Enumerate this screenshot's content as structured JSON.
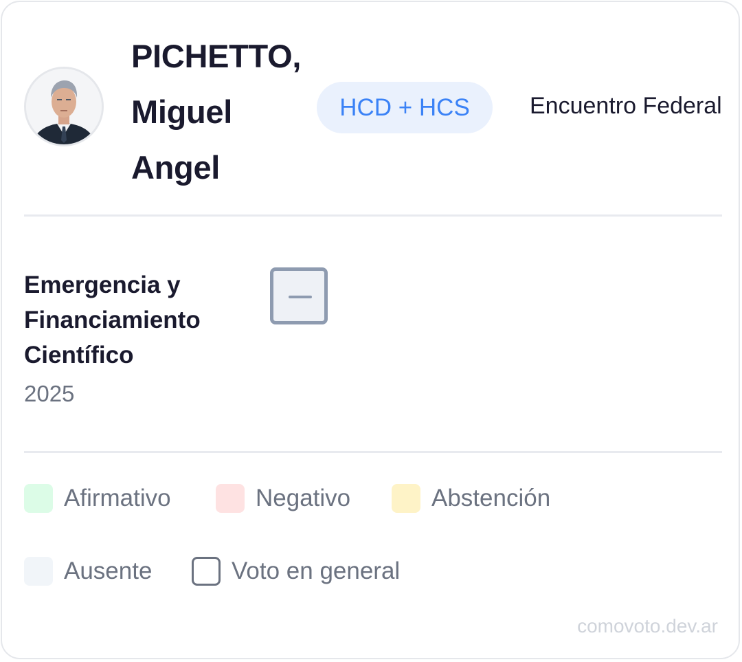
{
  "legislator": {
    "name_lines": [
      "PICHETTO,",
      "Miguel",
      "Angel"
    ],
    "photo_icon": "person-photo",
    "chamber_badge": "HCD + HCS",
    "party": "Encuentro Federal"
  },
  "vote": {
    "title_lines": [
      "Emergencia y",
      "Financiamiento",
      "Científico"
    ],
    "year": "2025",
    "result_icon": "minus-box-icon",
    "result_color": "#8e9bb0"
  },
  "legend": {
    "items": [
      {
        "label": "Afirmativo",
        "color": "#dcfce7"
      },
      {
        "label": "Negativo",
        "color": "#fee2e2"
      },
      {
        "label": "Abstención",
        "color": "#fef3c7"
      },
      {
        "label": "Ausente",
        "color": "#f1f5f9"
      },
      {
        "label": "Voto en general",
        "color": "#ffffff"
      }
    ]
  },
  "footer": {
    "watermark": "comovoto.dev.ar"
  }
}
